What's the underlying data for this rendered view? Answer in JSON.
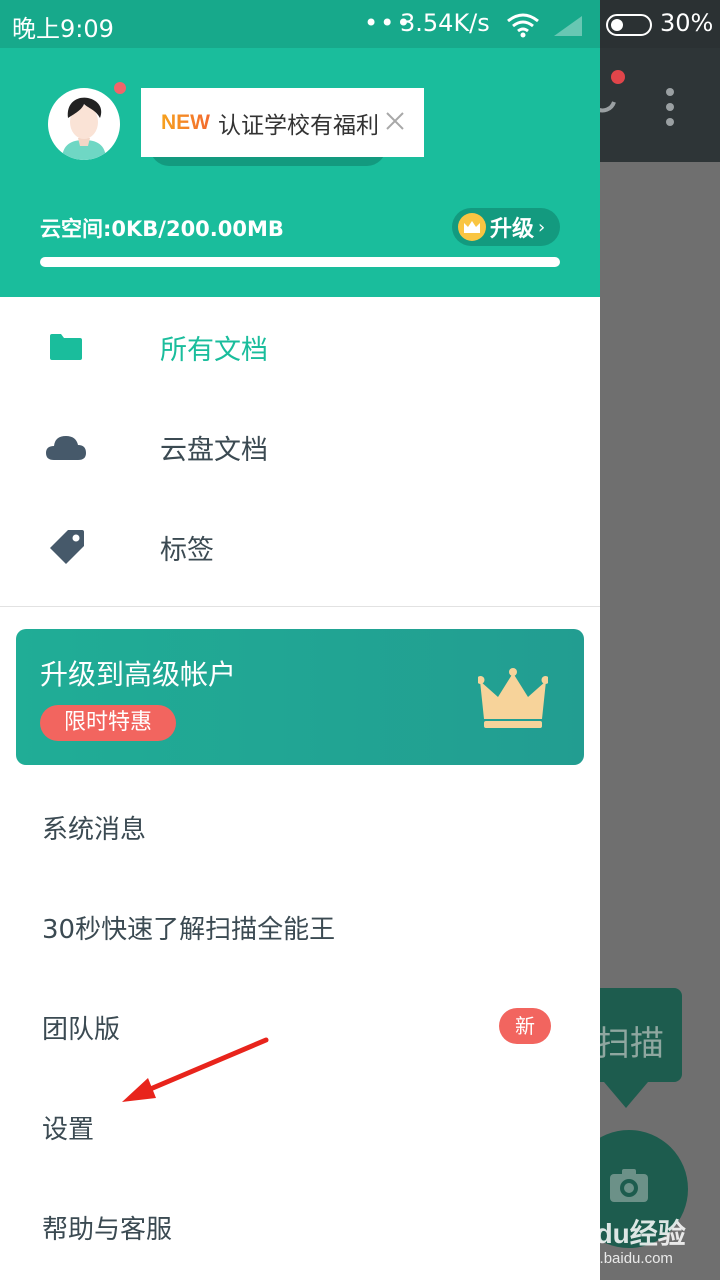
{
  "status_bar": {
    "time": "晚上9:09",
    "dots": "•••",
    "net_speed": "3.54K/s",
    "battery": "30%"
  },
  "header": {
    "promo_new": "NEW",
    "promo_text": "认证学校有福利",
    "storage": "云空间:0KB/200.00MB",
    "storage_used_fraction": 0.0,
    "upgrade_label": "升级"
  },
  "nav": {
    "items": [
      {
        "label": "所有文档",
        "icon": "folder-icon",
        "active": true
      },
      {
        "label": "云盘文档",
        "icon": "cloud-icon",
        "active": false
      },
      {
        "label": "标签",
        "icon": "tag-icon",
        "active": false
      }
    ]
  },
  "upgrade_card": {
    "title": "升级到高级帐户",
    "badge": "限时特惠"
  },
  "menu": {
    "items": [
      {
        "label": "系统消息"
      },
      {
        "label": "30秒快速了解扫描全能王"
      },
      {
        "label": "团队版",
        "badge": "新"
      },
      {
        "label": "设置"
      },
      {
        "label": "帮助与客服"
      }
    ]
  },
  "background": {
    "scan_label": "扫描"
  },
  "watermark": {
    "logo": "Baidu经验",
    "url": "jingyan.baidu.com"
  },
  "colors": {
    "accent": "#1abd9c",
    "badge": "#f2655f",
    "text": "#3b4a52"
  }
}
